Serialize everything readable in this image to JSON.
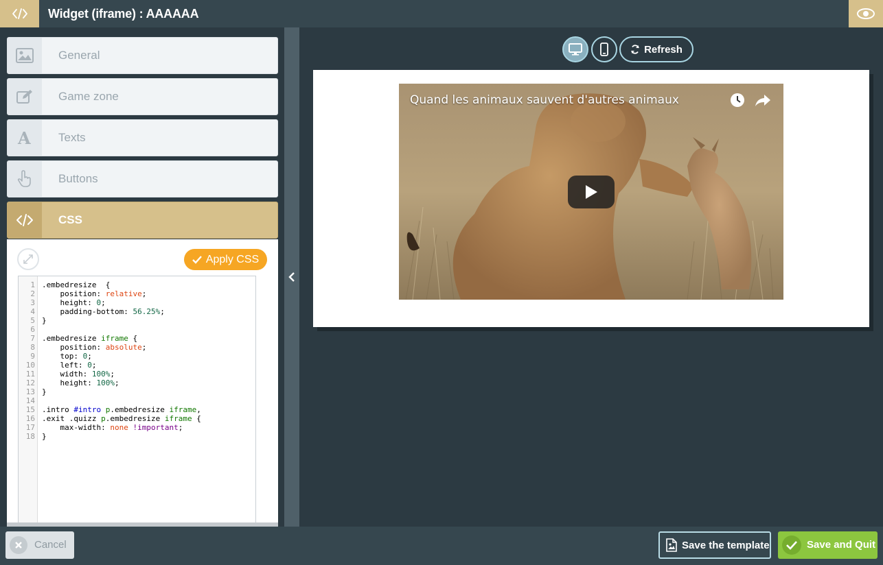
{
  "header": {
    "title": "Widget (iframe) : AAAAAA"
  },
  "sidebar": {
    "items": [
      {
        "label": "General",
        "icon": "image-icon"
      },
      {
        "label": "Game zone",
        "icon": "edit-icon"
      },
      {
        "label": "Texts",
        "icon": "font-icon"
      },
      {
        "label": "Buttons",
        "icon": "hand-pointer-icon"
      },
      {
        "label": "CSS",
        "icon": "code-icon"
      }
    ],
    "css_panel": {
      "apply_label": "Apply CSS",
      "code_lines": [
        ".embedresize  {",
        "    position: relative;",
        "    height: 0;",
        "    padding-bottom: 56.25%;",
        "}",
        "",
        ".embedresize iframe {",
        "    position: absolute;",
        "    top: 0;",
        "    left: 0;",
        "    width: 100%;",
        "    height: 100%;",
        "}",
        "",
        ".intro #intro p.embedresize iframe,",
        ".exit .quizz p.embedresize iframe {",
        "    max-width: none !important;",
        "}"
      ]
    }
  },
  "preview": {
    "refresh_label": "Refresh",
    "video_title": "Quand les animaux sauvent d'autres animaux"
  },
  "footer": {
    "cancel_label": "Cancel",
    "save_template_label": "Save the template",
    "save_quit_label": "Save and Quit"
  },
  "colors": {
    "accent_gold": "#d6c08b",
    "apply_orange": "#f6a623",
    "save_green": "#8cc63f",
    "dark_bg": "#2c3a42"
  }
}
